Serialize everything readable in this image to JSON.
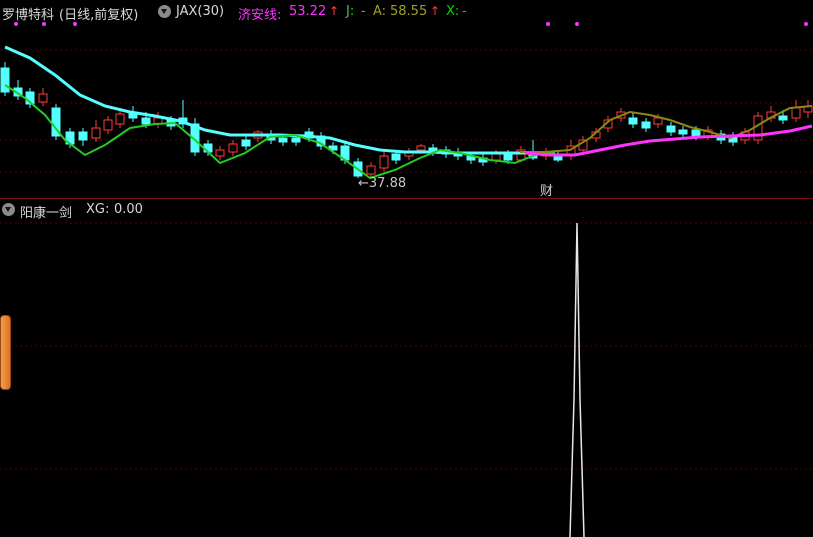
{
  "header": {
    "title": "罗博特科",
    "period": "(日线,前复权)",
    "indicator": "JAX(30)",
    "jiaxian_label": "济安线:",
    "jiaxian_value": "53.22",
    "j_label": "J:",
    "j_value": "-",
    "a_label": "A:",
    "a_value": "58.55",
    "x_label": "X:",
    "x_value": "-",
    "arrow": "↑"
  },
  "main_chart": {
    "low_marker": "←37.88",
    "event_marker": "财"
  },
  "sub_chart": {
    "title": "阳康一剑",
    "xg_label": "XG:",
    "xg_value": "0.00"
  },
  "colors": {
    "background": "#000000",
    "up_candle": "#ff3c3c",
    "down_candle": "#54ffff",
    "jiaxian": "#ff33ff",
    "j_line": "#33cc33",
    "a_line": "#808000",
    "x_line": "#00dd00",
    "ma_line": "#54ffff",
    "grid": "#5a0000"
  }
}
